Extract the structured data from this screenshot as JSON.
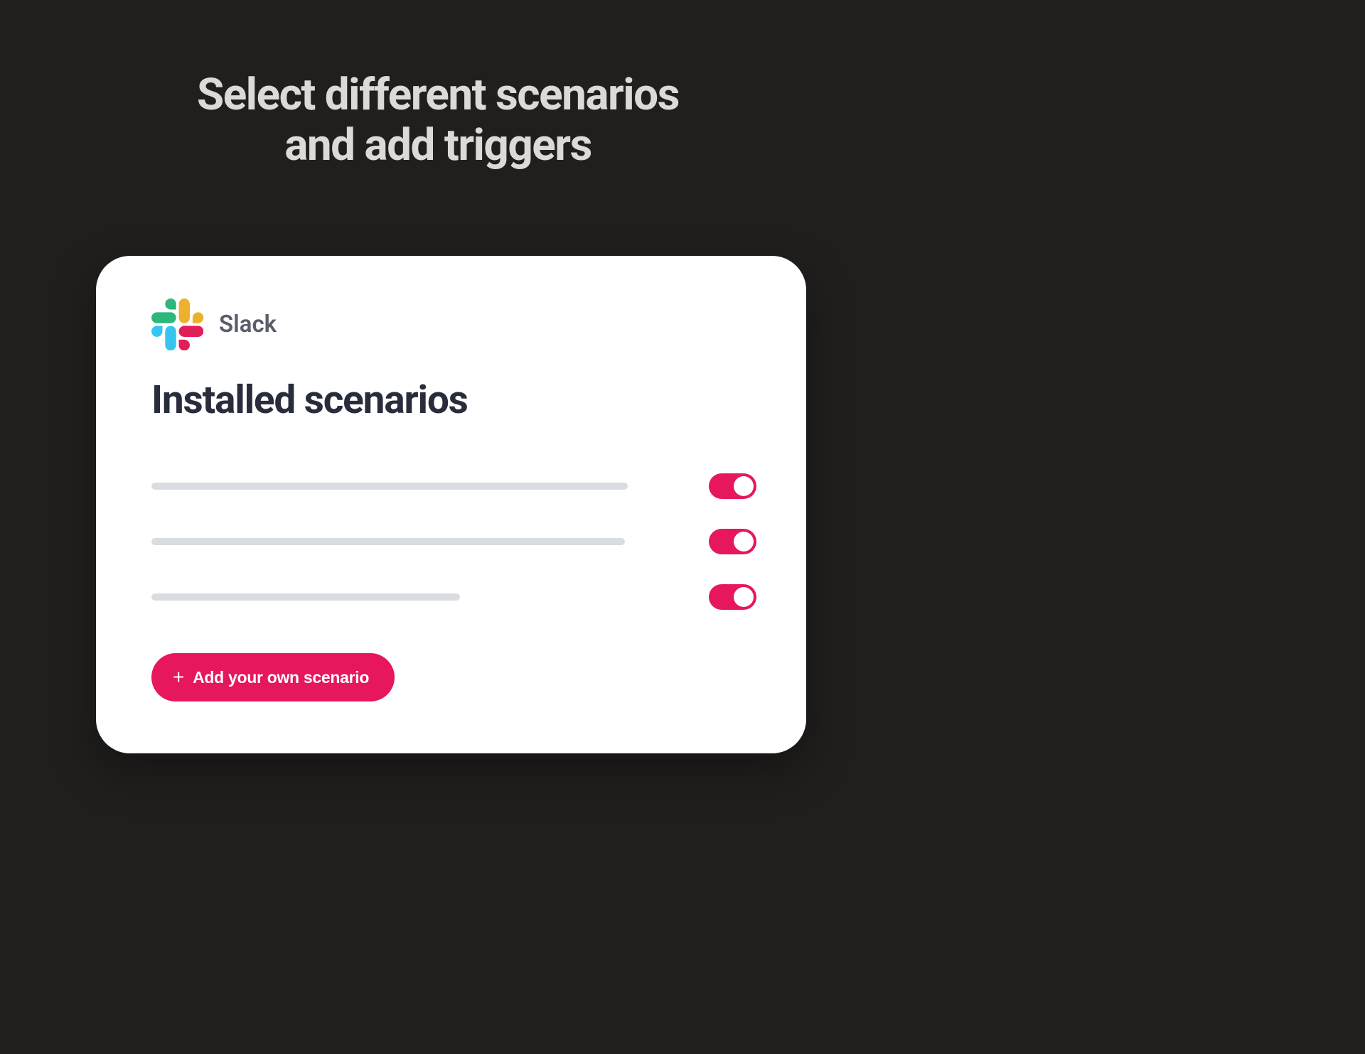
{
  "header": {
    "title_line1": "Select different scenarios",
    "title_line2": "and add triggers"
  },
  "card": {
    "app_name": "Slack",
    "section_title": "Installed scenarios",
    "scenarios": [
      {
        "toggle_on": true
      },
      {
        "toggle_on": true
      },
      {
        "toggle_on": true
      }
    ],
    "add_button_label": "Add your own scenario"
  },
  "colors": {
    "accent": "#e6175c",
    "bg": "#211f1e",
    "card_bg": "#ffffff"
  }
}
